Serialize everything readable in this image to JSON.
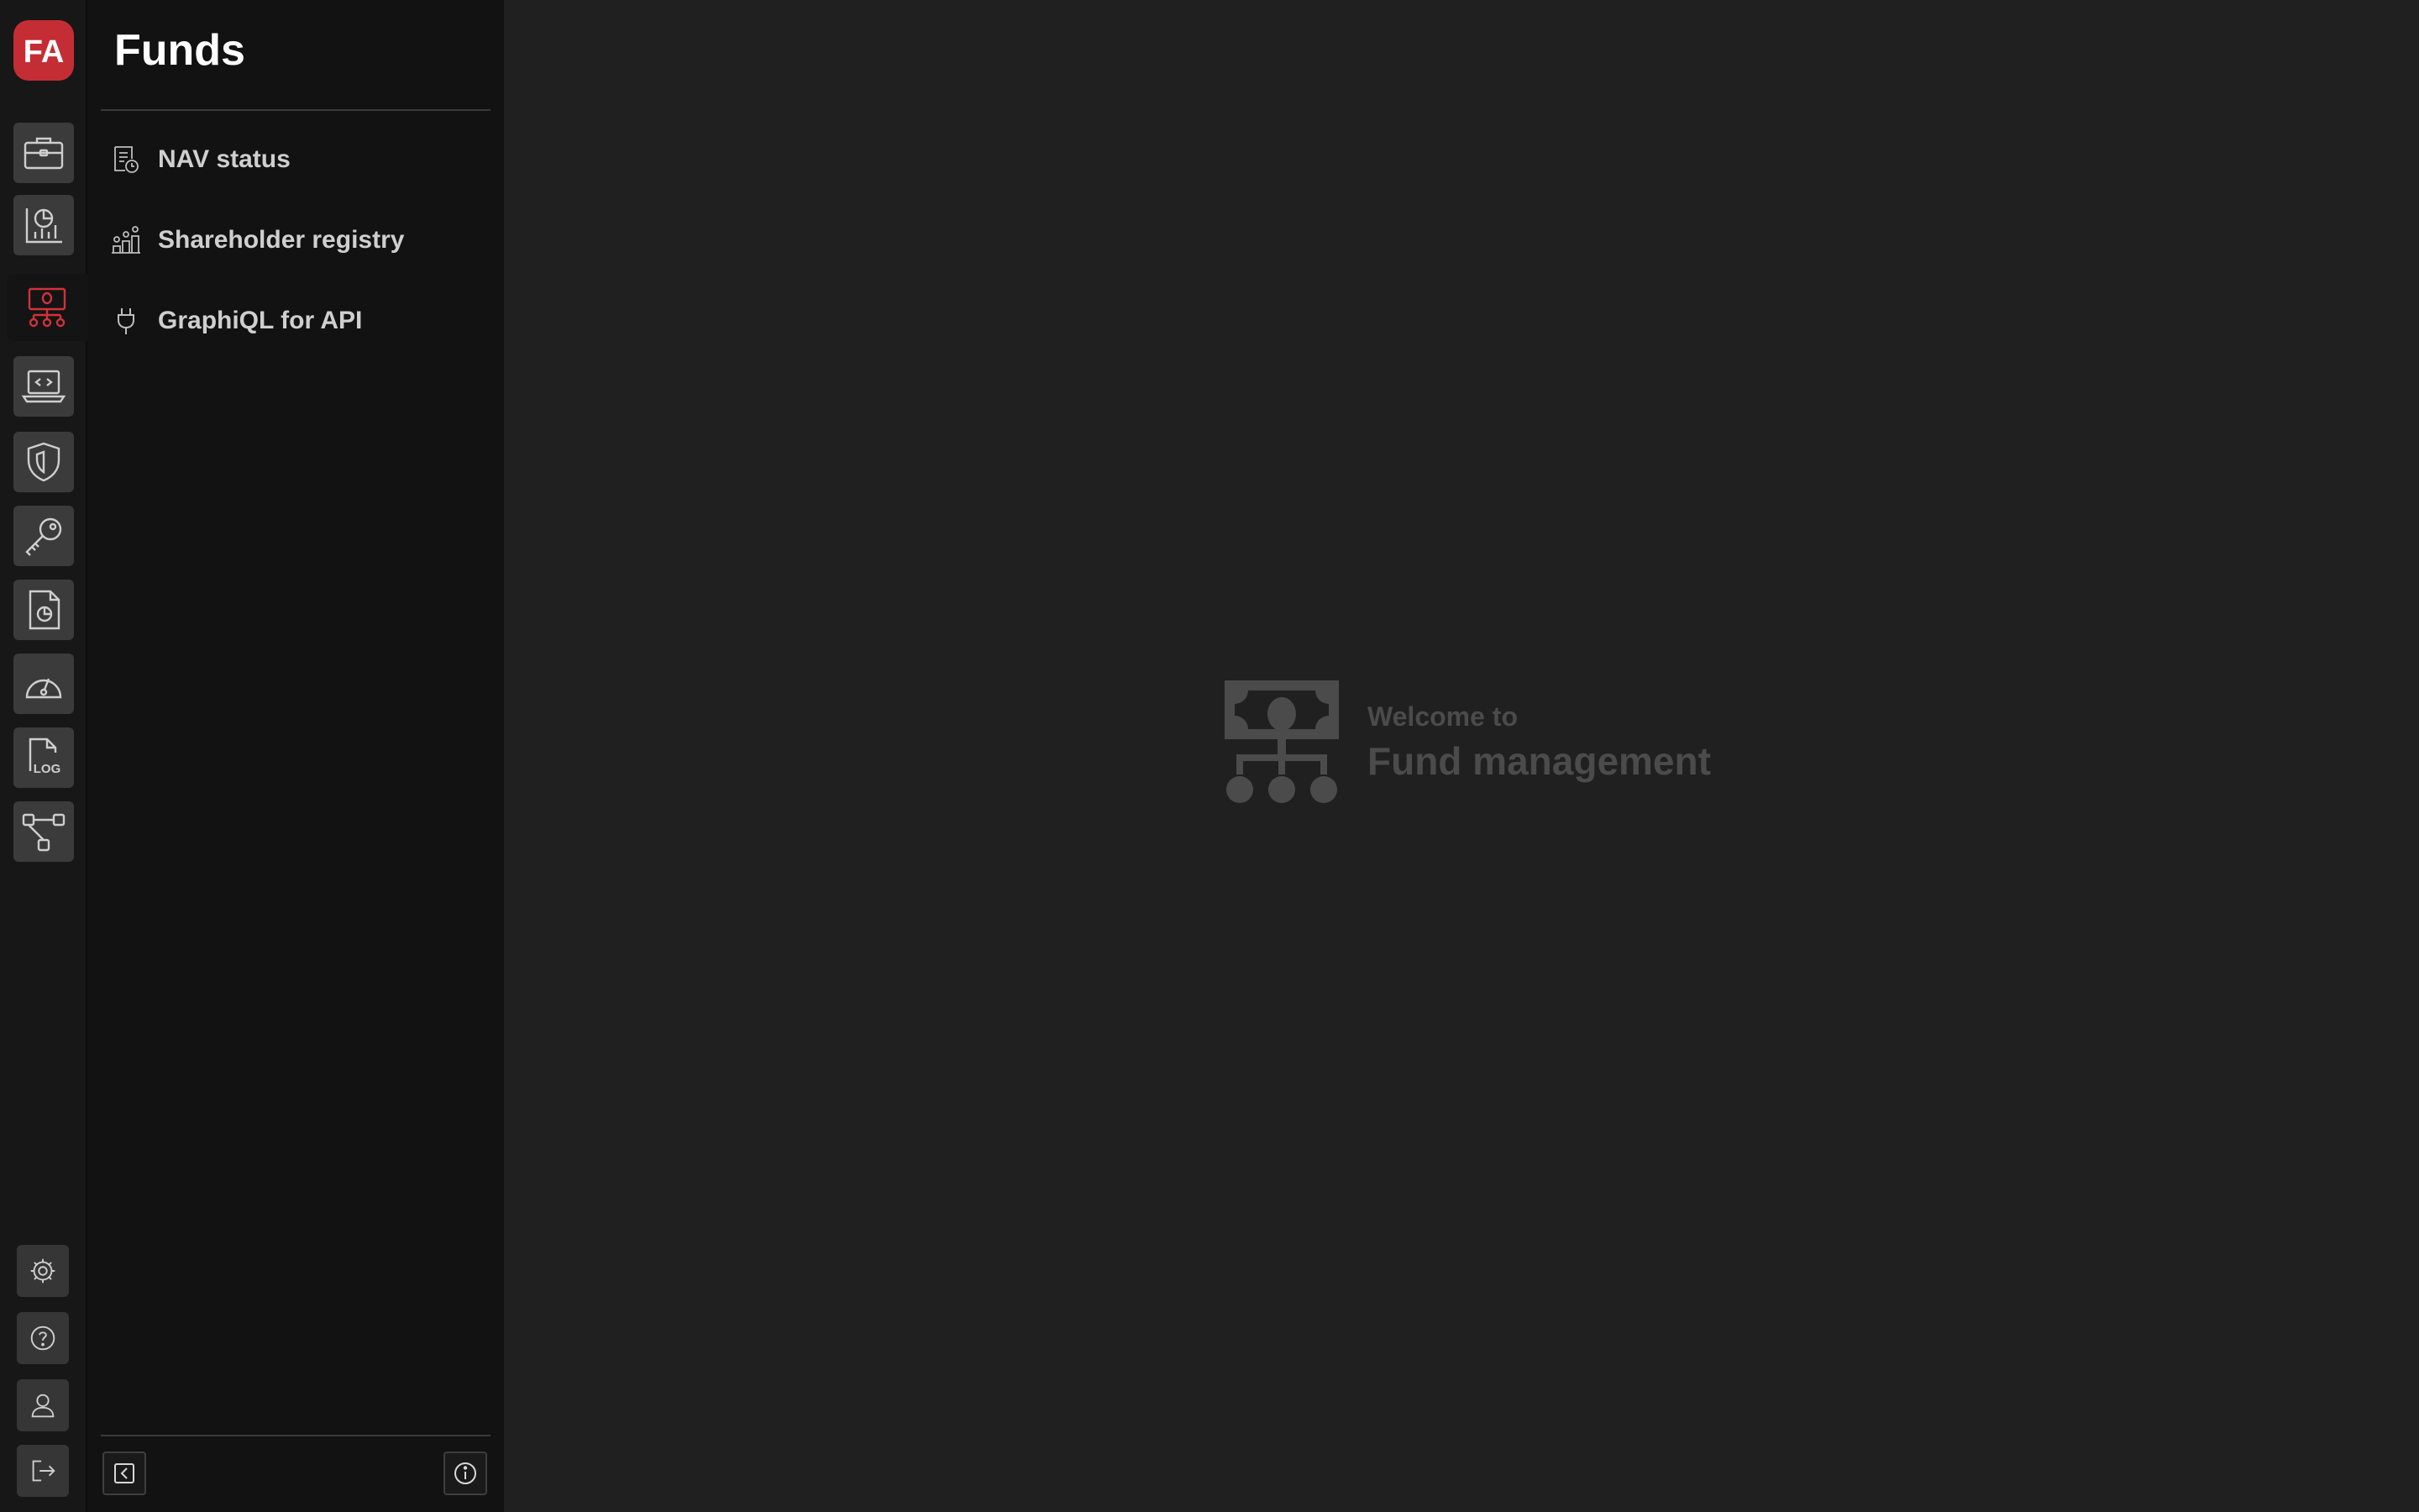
{
  "brand": {
    "logo_text": "FA",
    "logo_color": "#c52d34",
    "accent_color": "#d0323a"
  },
  "rail": {
    "items": [
      {
        "name": "portfolio",
        "icon": "briefcase-icon",
        "active": false
      },
      {
        "name": "analytics",
        "icon": "chart-pie-icon",
        "active": false
      },
      {
        "name": "funds",
        "icon": "money-network-icon",
        "active": true
      },
      {
        "name": "developer",
        "icon": "laptop-code-icon",
        "active": false
      },
      {
        "name": "security",
        "icon": "shield-icon",
        "active": false
      },
      {
        "name": "keys",
        "icon": "key-icon",
        "active": false
      },
      {
        "name": "reports",
        "icon": "document-chart-icon",
        "active": false
      },
      {
        "name": "dashboard",
        "icon": "gauge-icon",
        "active": false
      },
      {
        "name": "logs",
        "icon": "log-file-icon",
        "active": false
      },
      {
        "name": "workflows",
        "icon": "flow-icon",
        "active": false
      }
    ],
    "bottom": [
      {
        "name": "settings",
        "icon": "gear-icon"
      },
      {
        "name": "help",
        "icon": "question-icon"
      },
      {
        "name": "profile",
        "icon": "user-icon"
      },
      {
        "name": "logout",
        "icon": "logout-icon"
      }
    ]
  },
  "sidebar": {
    "title": "Funds",
    "items": [
      {
        "label": "NAV status",
        "icon": "report-clock-icon"
      },
      {
        "label": "Shareholder registry",
        "icon": "people-chart-icon"
      },
      {
        "label": "GraphiQL for API",
        "icon": "plug-icon"
      }
    ],
    "footer": {
      "collapse_icon": "collapse-left-icon",
      "info_icon": "info-icon"
    }
  },
  "main": {
    "welcome_sub": "Welcome to",
    "welcome_main": "Fund management",
    "illustration_icon": "money-network-icon"
  }
}
